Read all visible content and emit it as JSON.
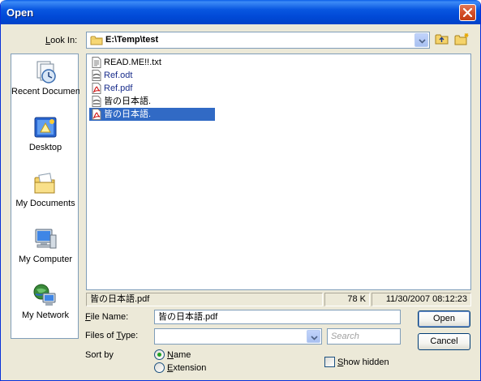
{
  "window": {
    "title": "Open"
  },
  "look_in": {
    "label_prefix": "",
    "label_accel": "L",
    "label_rest": "ook In:",
    "value": "E:\\Temp\\test"
  },
  "places": [
    {
      "label": "Recent Documents",
      "icon": "recent-documents-icon"
    },
    {
      "label": "Desktop",
      "icon": "desktop-icon"
    },
    {
      "label": "My Documents",
      "icon": "my-documents-icon"
    },
    {
      "label": "My Computer",
      "icon": "my-computer-icon"
    },
    {
      "label": "My Network",
      "icon": "my-network-icon"
    }
  ],
  "files": [
    {
      "name": "READ.ME!!.txt",
      "icon": "text-file-icon",
      "selected": false
    },
    {
      "name": "Ref.odt",
      "icon": "document-file-icon",
      "selected": false
    },
    {
      "name": "Ref.pdf",
      "icon": "pdf-file-icon",
      "selected": false
    },
    {
      "name": "皆の日本語.",
      "icon": "document-file-icon",
      "selected": false
    },
    {
      "name": "皆の日本語.",
      "icon": "pdf-file-icon",
      "selected": true
    }
  ],
  "status_bar": {
    "filename": "皆の日本語.pdf",
    "size": "78 K",
    "modified": "11/30/2007 08:12:23"
  },
  "file_name": {
    "label_accel": "F",
    "label_rest": "ile Name:",
    "value": "皆の日本語.pdf"
  },
  "files_of_type": {
    "label_prefix": "Files of ",
    "label_accel": "T",
    "label_rest": "ype:",
    "value": ""
  },
  "search": {
    "placeholder": "Search"
  },
  "sort_by": {
    "label": "Sort by",
    "options": [
      {
        "accel": "N",
        "rest": "ame",
        "checked": true
      },
      {
        "accel": "E",
        "rest": "xtension",
        "checked": false
      }
    ]
  },
  "show_hidden": {
    "accel": "S",
    "rest": "how hidden",
    "checked": false
  },
  "buttons": {
    "open": "Open",
    "cancel": "Cancel"
  }
}
